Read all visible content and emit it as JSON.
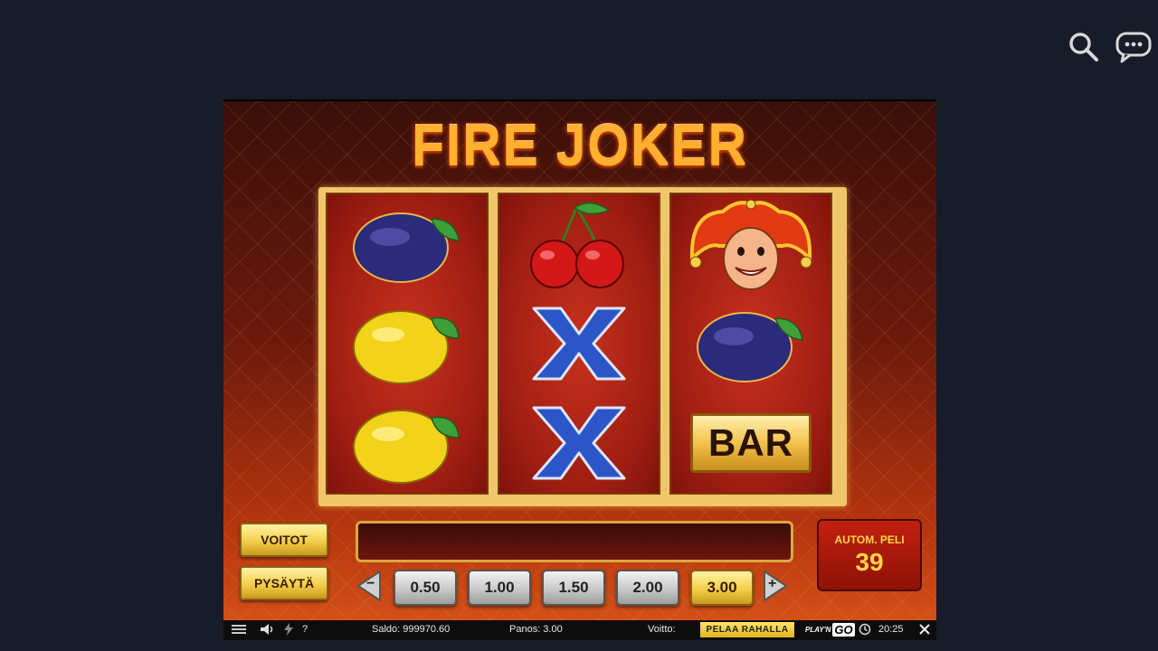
{
  "header": {
    "search_icon": "search-icon",
    "chat_icon": "chat-bubble-icon"
  },
  "game": {
    "title": "FIRE JOKER",
    "reels": [
      [
        "plum",
        "lemon",
        "lemon"
      ],
      [
        "cherry",
        "x",
        "x"
      ],
      [
        "joker",
        "plum",
        "bar"
      ]
    ],
    "bar_label": "BAR",
    "buttons": {
      "wins": "VOITOT",
      "stop": "PYSÄYTÄ"
    },
    "autoplay": {
      "label": "AUTOM. PELI",
      "count": "39"
    },
    "bet_options": [
      "0.50",
      "1.00",
      "1.50",
      "2.00",
      "3.00"
    ],
    "selected_bet": "3.00",
    "minus_label": "−",
    "plus_label": "+"
  },
  "statusbar": {
    "balance": "Saldo: 999970.60",
    "bet": "Panos: 3.00",
    "win": "Voitto:",
    "real_money": "PELAA RAHALLA",
    "logo_prefix": "PLAY'N",
    "logo_go": "GO",
    "clock": "20:25",
    "help": "?"
  },
  "colors": {
    "accent_gold": "#f3cf4a",
    "reel_red": "#b5261a",
    "background": "#181b28"
  }
}
